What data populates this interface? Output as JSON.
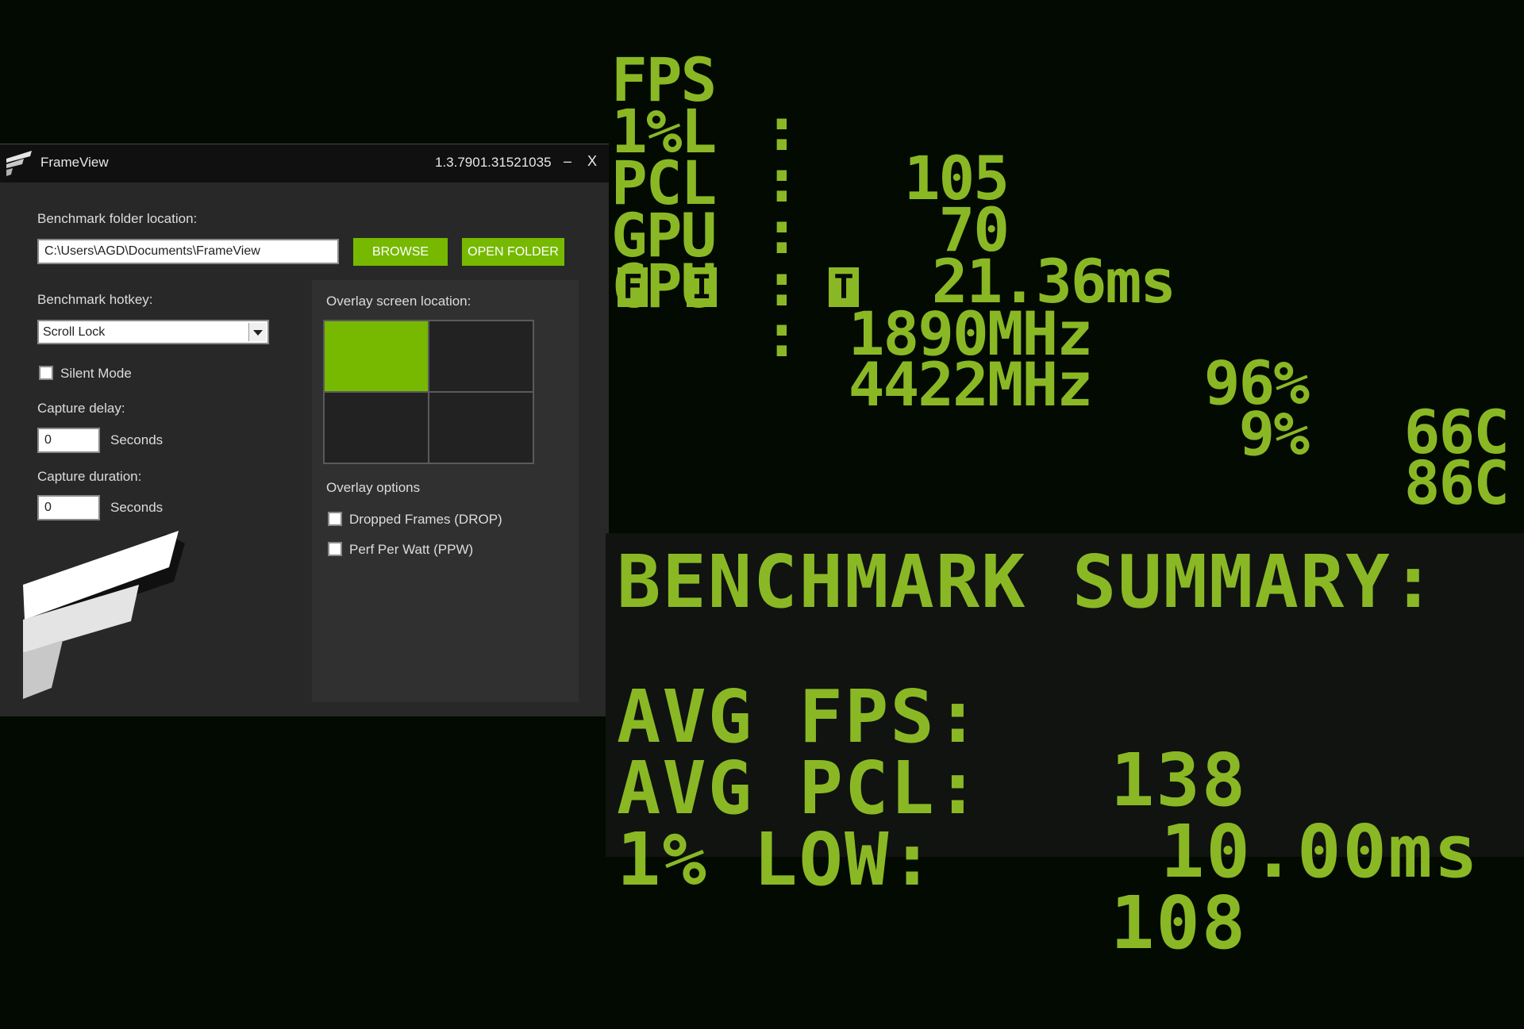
{
  "window": {
    "title": "FrameView",
    "version": "1.3.7901.31521035",
    "minimize": "–",
    "close": "X"
  },
  "settings": {
    "folder_label": "Benchmark folder location:",
    "folder_value": "C:\\Users\\AGD\\Documents\\FrameView",
    "browse_label": "BROWSE",
    "open_folder_label": "OPEN FOLDER",
    "hotkey_label": "Benchmark hotkey:",
    "hotkey_value": "Scroll Lock",
    "silent_mode_label": "Silent Mode",
    "silent_mode_checked": false,
    "capture_delay_label": "Capture delay:",
    "capture_delay_value": "0",
    "capture_delay_unit": "Seconds",
    "capture_duration_label": "Capture duration:",
    "capture_duration_value": "0",
    "capture_duration_unit": "Seconds"
  },
  "overlay": {
    "location_label": "Overlay screen location:",
    "selected_location": "top-left",
    "options_label": "Overlay options",
    "options": [
      {
        "label": "Dropped Frames (DROP)",
        "checked": false
      },
      {
        "label": "Perf Per Watt (PPW)",
        "checked": false
      }
    ]
  },
  "stats": {
    "colon": ":",
    "fps": {
      "label": "FPS",
      "value": "105"
    },
    "one_pct_low": {
      "label": "1%L",
      "value": "70"
    },
    "pcl": {
      "label": "PCL",
      "value": "21.36ms"
    },
    "gpu": {
      "label": "GPU",
      "clock": "1890MHz",
      "load": "96%",
      "temp": "66C"
    },
    "cpu": {
      "label": "CPU",
      "clock": "4422MHz",
      "load": "9%",
      "temp": "86C"
    },
    "badges": [
      "F",
      "I",
      "T"
    ]
  },
  "summary": {
    "title": "BENCHMARK SUMMARY:",
    "avg_fps": {
      "label": "AVG FPS:",
      "value": "138"
    },
    "avg_pcl": {
      "label": "AVG PCL:",
      "value": "10.00ms"
    },
    "one_pct_low": {
      "label": "1% LOW:",
      "value": "108"
    }
  },
  "colors": {
    "accent": "#76b900",
    "overlay_text": "#8ab825",
    "background": "#020a02"
  }
}
